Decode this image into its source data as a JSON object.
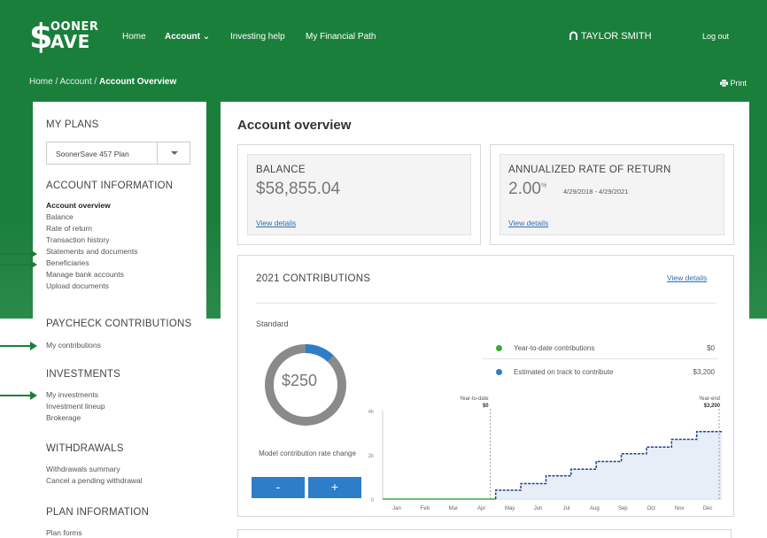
{
  "header": {
    "logo_line1": "OONER",
    "logo_line2": "AVE",
    "nav": [
      "Home",
      "Account ⌄",
      "Investing help",
      "My Financial Path"
    ],
    "user": "TAYLOR SMITH",
    "logout": "Log out"
  },
  "breadcrumb": {
    "home": "Home",
    "sep": "/",
    "account": "Account",
    "current": "Account Overview",
    "print": "Print"
  },
  "sidebar": {
    "my_plans": "MY PLANS",
    "plan_select": "SoonerSave 457 Plan",
    "account_info": "ACCOUNT INFORMATION",
    "account_items": [
      "Account overview",
      "Balance",
      "Rate of return",
      "Transaction history",
      "Statements and documents",
      "Beneficiaries",
      "Manage bank accounts",
      "Upload documents"
    ],
    "paycheck": "PAYCHECK CONTRIBUTIONS",
    "paycheck_items": [
      "My contributions"
    ],
    "investments": "INVESTMENTS",
    "investment_items": [
      "My investments",
      "Investment lineup",
      "Brokerage"
    ],
    "withdrawals": "WITHDRAWALS",
    "withdrawal_items": [
      "Withdrawals summary",
      "Cancel a pending withdrawal"
    ],
    "plan_info": "PLAN INFORMATION",
    "plan_info_items": [
      "Plan forms"
    ]
  },
  "main": {
    "title": "Account overview",
    "balance_label": "BALANCE",
    "balance_value": "$58,855.04",
    "balance_link": "View details",
    "ror_label": "ANNUALIZED RATE OF RETURN",
    "ror_value": "2.00",
    "ror_unit": "%",
    "ror_dates": "4/29/2018 - 4/29/2021",
    "ror_link": "View details",
    "contrib_title": "2021 CONTRIBUTIONS",
    "contrib_link": "View details",
    "standard": "Standard",
    "donut_value": "$250",
    "model_text": "Model contribution rate change",
    "minus": "-",
    "plus": "+",
    "legend": [
      {
        "label": "Year-to-date contributions",
        "value": "$0",
        "color": "#3aaa3a"
      },
      {
        "label": "Estimated on track to contribute",
        "value": "$3,200",
        "color": "#2d7dc9"
      }
    ]
  },
  "donut": {
    "fraction": 0.12,
    "color": "#2d7dc9",
    "track": "#8a8a8a"
  },
  "chart_data": {
    "type": "line",
    "categories": [
      "Jan",
      "Feb",
      "Mar",
      "Apr",
      "May",
      "Jun",
      "Jul",
      "Aug",
      "Sep",
      "Oct",
      "Nov",
      "Dec"
    ],
    "yticks": [
      "0",
      "2k",
      "4k"
    ],
    "ylim": [
      0,
      4000
    ],
    "ytd_label": "Year-to-date",
    "ytd_value": "$0",
    "ye_label": "Year-end",
    "ye_value": "$3,200",
    "series": [
      {
        "values": [
          0,
          0,
          0,
          0
        ]
      },
      {
        "values": [
          400,
          700,
          1050,
          1350,
          1700,
          2050,
          2350,
          2700,
          3050
        ]
      }
    ],
    "colors": {
      "ytd": "#3aaa3a",
      "est": "#1f3f8f",
      "fill": "#e7eef8"
    }
  }
}
